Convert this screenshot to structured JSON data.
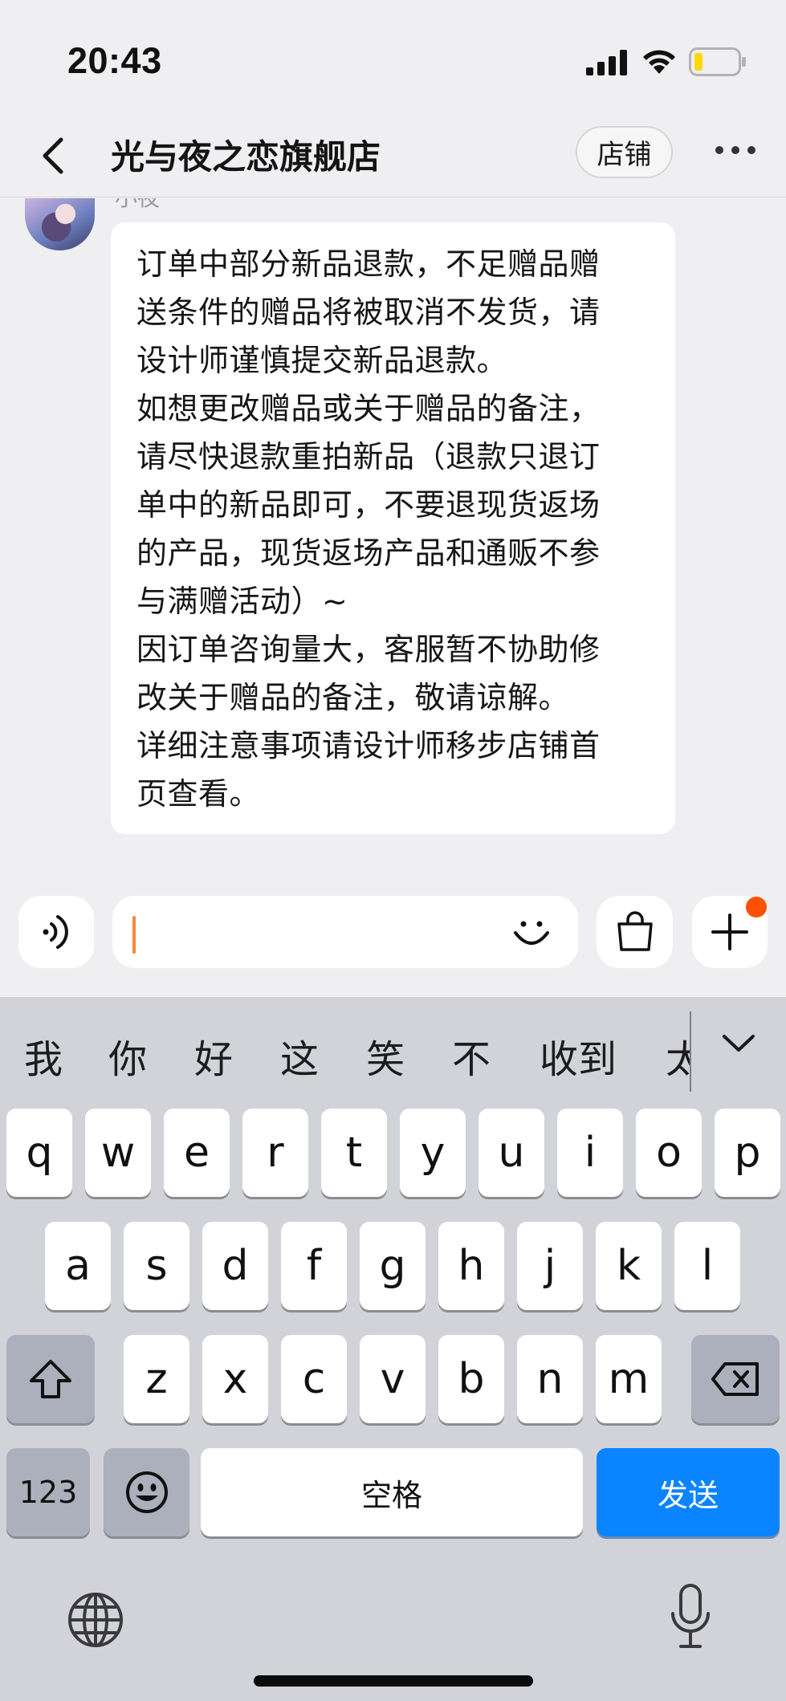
{
  "status_bar": {
    "time": "20:43"
  },
  "header": {
    "title": "光与夜之恋旗舰店",
    "shop_button": "店铺"
  },
  "chat": {
    "sender_name": "小夜",
    "message": "订单中部分新品退款，不足赠品赠\n送条件的赠品将被取消不发货，请\n设计师谨慎提交新品退款。\n如想更改赠品或关于赠品的备注，\n请尽快退款重拍新品（退款只退订\n单中的新品即可，不要退现货返场\n的产品，现货返场产品和通贩不参\n与满赠活动）~\n因订单咨询量大，客服暂不协助修\n改关于赠品的备注，敬请谅解。\n详细注意事项请设计师移步店铺首\n页查看。"
  },
  "input": {
    "value": ""
  },
  "keyboard": {
    "candidates": [
      "我",
      "你",
      "好",
      "这",
      "笑",
      "不",
      "收到",
      "太"
    ],
    "row1": [
      "q",
      "w",
      "e",
      "r",
      "t",
      "y",
      "u",
      "i",
      "o",
      "p"
    ],
    "row2": [
      "a",
      "s",
      "d",
      "f",
      "g",
      "h",
      "j",
      "k",
      "l"
    ],
    "row3": [
      "z",
      "x",
      "c",
      "v",
      "b",
      "n",
      "m"
    ],
    "numbers_key": "123",
    "space_key": "空格",
    "send_key": "发送"
  },
  "colors": {
    "send_key": "#0a84ff",
    "notification_dot": "#fe5000",
    "caret": "#f08a3c",
    "battery_level": "#ffd60a"
  },
  "battery_level": 0.2
}
